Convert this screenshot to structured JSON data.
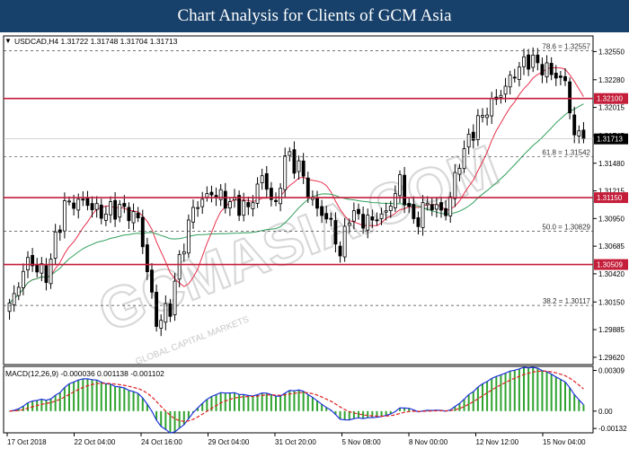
{
  "banner_title": "Chart Analysis for Clients of GCM Asia",
  "watermark": {
    "main": "GCMASIA.COM",
    "sub": "GLOBAL CAPITAL MARKETS"
  },
  "colors": {
    "up_candle": "#ffffff",
    "down_candle": "#000000",
    "wick": "#000000",
    "ma_fast": "#e8304c",
    "ma_slow": "#2f9e5a",
    "hline": "#c41e3a",
    "macd_line": "#2233dd",
    "signal_line": "#e02020",
    "histogram": "#2fa32f"
  },
  "chart_data": [
    {
      "type": "candlestick",
      "symbol_info": "USDCAD,H4  1.31722 1.31748 1.31704 1.31713",
      "y_ticks": [
        "1.32550",
        "1.32280",
        "1.32015",
        "1.31745",
        "1.31480",
        "1.31215",
        "1.30950",
        "1.30685",
        "1.30420",
        "1.30150",
        "1.29885",
        "1.29620"
      ],
      "ylim": [
        1.2955,
        1.327
      ],
      "x_ticks": [
        "17 Oct 2018",
        "22 Oct 04:00",
        "24 Oct 16:00",
        "29 Oct 04:00",
        "31 Oct 20:00",
        "5 Nov 08:00",
        "8 Nov 00:00",
        "12 Nov 12:00",
        "15 Nov 04:00"
      ],
      "price_badges": [
        {
          "value": 1.321,
          "label": "1.32100",
          "kind": "level"
        },
        {
          "value": 1.31713,
          "label": "1.31713",
          "kind": "current"
        },
        {
          "value": 1.3115,
          "label": "1.31150",
          "kind": "level"
        },
        {
          "value": 1.30509,
          "label": "1.30509",
          "kind": "level"
        }
      ],
      "fib_levels": [
        {
          "value": 1.32557,
          "label": "78.6 = 1.32557"
        },
        {
          "value": 1.31542,
          "label": "61.8 = 1.31542"
        },
        {
          "value": 1.30829,
          "label": "50.0 = 1.30829"
        },
        {
          "value": 1.30117,
          "label": "38.2 = 1.30117"
        }
      ],
      "current_price": 1.31713,
      "path_anchors": [
        [
          0,
          1.301
        ],
        [
          4,
          1.3055
        ],
        [
          8,
          1.304
        ],
        [
          12,
          1.3108
        ],
        [
          16,
          1.3112
        ],
        [
          20,
          1.31
        ],
        [
          24,
          1.3105
        ],
        [
          28,
          1.3095
        ],
        [
          32,
          1.2995
        ],
        [
          35,
          1.301
        ],
        [
          37,
          1.3055
        ],
        [
          40,
          1.3105
        ],
        [
          44,
          1.312
        ],
        [
          48,
          1.311
        ],
        [
          52,
          1.3105
        ],
        [
          55,
          1.3135
        ],
        [
          58,
          1.3105
        ],
        [
          60,
          1.3155
        ],
        [
          63,
          1.3145
        ],
        [
          66,
          1.311
        ],
        [
          70,
          1.309
        ],
        [
          72,
          1.306
        ],
        [
          74,
          1.31
        ],
        [
          78,
          1.3092
        ],
        [
          82,
          1.31
        ],
        [
          85,
          1.313
        ],
        [
          88,
          1.309
        ],
        [
          91,
          1.311
        ],
        [
          95,
          1.31
        ],
        [
          98,
          1.315
        ],
        [
          101,
          1.318
        ],
        [
          104,
          1.32
        ],
        [
          107,
          1.3215
        ],
        [
          110,
          1.3235
        ],
        [
          113,
          1.3248
        ],
        [
          116,
          1.324
        ],
        [
          119,
          1.3232
        ],
        [
          121,
          1.3225
        ],
        [
          123,
          1.3175
        ],
        [
          125,
          1.3171
        ]
      ]
    },
    {
      "type": "line",
      "indicator_label": "MACD(12,26,9) -0.000036 0.001138 -0.001102",
      "y_ticks": [
        "0.00309",
        "0.00",
        "-0.00132"
      ],
      "ylim": [
        -0.00165,
        0.0034
      ]
    }
  ]
}
